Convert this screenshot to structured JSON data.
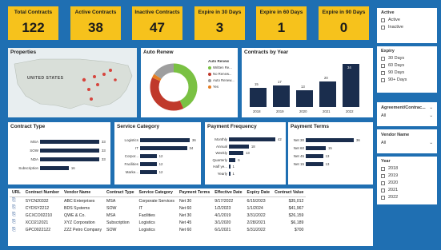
{
  "kpis": [
    {
      "title": "Total Contracts",
      "value": "122"
    },
    {
      "title": "Active Contracts",
      "value": "38"
    },
    {
      "title": "Inactive Contracts",
      "value": "47"
    },
    {
      "title": "Expire in 30 Days",
      "value": "3"
    },
    {
      "title": "Expire in 60 Days",
      "value": "1"
    },
    {
      "title": "Expire in 90 Days",
      "value": "0"
    }
  ],
  "colors": {
    "background": "#1f6fb2",
    "kpi": "#f6c21c",
    "bar": "#1a2d4d",
    "donut_green": "#7ac143",
    "donut_red": "#c0392b",
    "donut_grey": "#9e9e9e",
    "donut_orange": "#e67e22"
  },
  "properties": {
    "title": "Properties",
    "map_label": "UNITED STATES"
  },
  "autorenew": {
    "title": "Auto Renew",
    "legend_title": "Auto Renew",
    "legend": [
      {
        "label": "Written Re...",
        "color": "#7ac143"
      },
      {
        "label": "No Renew...",
        "color": "#c0392b"
      },
      {
        "label": "Auto Renew...",
        "color": "#9e9e9e"
      },
      {
        "label": "Yes",
        "color": "#e67e22"
      }
    ]
  },
  "contracts_by_year": {
    "title": "Contracts by Year",
    "chart_data": {
      "type": "bar",
      "categories": [
        "2018",
        "2019",
        "2020",
        "2021",
        "2022"
      ],
      "values": [
        15,
        17,
        13,
        20,
        34
      ]
    }
  },
  "contract_type": {
    "title": "Contract Type",
    "chart_data": {
      "type": "bar",
      "categories": [
        "MSA",
        "SOW",
        "NDA",
        "Subscription"
      ],
      "values": [
        33,
        33,
        33,
        16
      ]
    }
  },
  "service_category": {
    "title": "Service Category",
    "chart_data": {
      "type": "bar",
      "categories": [
        "Logistics",
        "IT",
        "Corpor...",
        "Facilities",
        "Marke..."
      ],
      "values": [
        36,
        34,
        12,
        12,
        12
      ]
    }
  },
  "payment_frequency": {
    "title": "Payment Frequency",
    "chart_data": {
      "type": "bar",
      "categories": [
        "Monthly",
        "Annual",
        "Weekly",
        "Quarterly",
        "Half ye...",
        "Yearly"
      ],
      "values": [
        42,
        18,
        13,
        6,
        1,
        1
      ]
    }
  },
  "payment_terms": {
    "title": "Payment Terms",
    "chart_data": {
      "type": "bar",
      "categories": [
        "Net 30",
        "Net 60",
        "Net 45",
        "Net 15"
      ],
      "values": [
        36,
        15,
        13,
        13
      ]
    }
  },
  "table": {
    "headers": [
      "URL",
      "Contract Number",
      "Vendor Name",
      "Contract Type",
      "Service Category",
      "Payment Terms",
      "Effective Date",
      "Expiry Date",
      "Contract Value"
    ],
    "rows": [
      [
        "SYCN20332",
        "ABC Enterprises",
        "MSA",
        "Corporate Services",
        "Net 30",
        "9/17/2022",
        "6/15/2023",
        "$35,012"
      ],
      [
        "CYDSY2212",
        "BDS Systems",
        "SOW",
        "IT",
        "Net 60",
        "1/2/2023",
        "1/1/2024",
        "$41,967"
      ],
      [
        "GCXCO02210",
        "QWE & Co.",
        "MSA",
        "Facilities",
        "Net 30",
        "4/1/2019",
        "3/31/2022",
        "$26,159"
      ],
      [
        "XCO212021",
        "XYZ Corporation",
        "Subscription",
        "Logistics",
        "Net 45",
        "3/1/2020",
        "2/28/2021",
        "$6,189"
      ],
      [
        "GPC0022122",
        "ZZZ Petro Company",
        "SOW",
        "Logistics",
        "Net 60",
        "6/1/2021",
        "5/31/2022",
        "$700"
      ]
    ]
  },
  "slicers": {
    "active": {
      "title": "Active",
      "options": [
        "Active",
        "Inactive"
      ]
    },
    "expiry": {
      "title": "Expiry",
      "options": [
        "30 Days",
        "60 Days",
        "90 Days",
        "90+ Days"
      ]
    },
    "agreement": {
      "title": "Agreement/Contrac...",
      "value": "All"
    },
    "vendor": {
      "title": "Vendor Name",
      "value": "All"
    },
    "year": {
      "title": "Year",
      "options": [
        "2018",
        "2019",
        "2020",
        "2021",
        "2022"
      ]
    }
  }
}
